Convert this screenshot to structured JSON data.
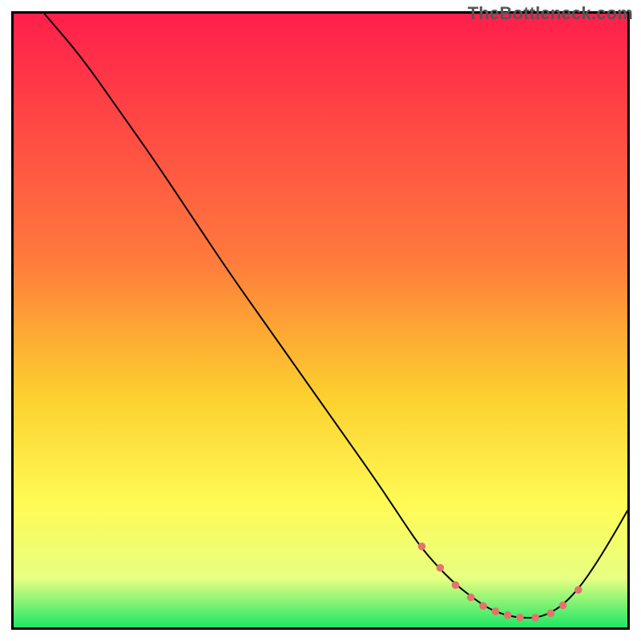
{
  "watermark": "TheBottleneck.com",
  "chart_data": {
    "type": "line",
    "title": "",
    "xlabel": "",
    "ylabel": "",
    "xlim": [
      0,
      100
    ],
    "ylim": [
      0,
      100
    ],
    "grid": false,
    "legend": false,
    "gradient_stops": [
      {
        "offset": 0,
        "color": "#ff1f4b"
      },
      {
        "offset": 40,
        "color": "#ff7a3c"
      },
      {
        "offset": 62,
        "color": "#fccf2e"
      },
      {
        "offset": 80,
        "color": "#fffb55"
      },
      {
        "offset": 92,
        "color": "#e7ff82"
      },
      {
        "offset": 100,
        "color": "#1fe665"
      }
    ],
    "series": [
      {
        "name": "bottleneck-curve",
        "stroke": "#000000",
        "stroke_width": 2,
        "x": [
          5,
          11,
          17,
          23,
          29,
          35,
          41,
          47,
          53,
          59,
          63,
          66,
          69,
          72,
          75,
          77,
          79,
          81,
          83.5,
          86,
          89,
          92,
          95,
          98,
          100
        ],
        "y": [
          100,
          93,
          84.5,
          76,
          67,
          58,
          49.5,
          41,
          32.5,
          24,
          18,
          13.5,
          10,
          7,
          4.7,
          3.3,
          2.4,
          1.8,
          1.5,
          1.7,
          3.2,
          6.2,
          10.5,
          15.5,
          19
        ]
      }
    ],
    "markers": {
      "name": "highlight-dots",
      "fill": "#e2746b",
      "radius": 4.8,
      "x": [
        66.5,
        69.5,
        72,
        74.5,
        76.5,
        78.5,
        80.5,
        82.5,
        85.0,
        87.5,
        89.5,
        92.0
      ],
      "y": [
        13.2,
        9.7,
        6.9,
        4.9,
        3.5,
        2.6,
        2.0,
        1.6,
        1.6,
        2.3,
        3.6,
        6.1
      ]
    }
  }
}
